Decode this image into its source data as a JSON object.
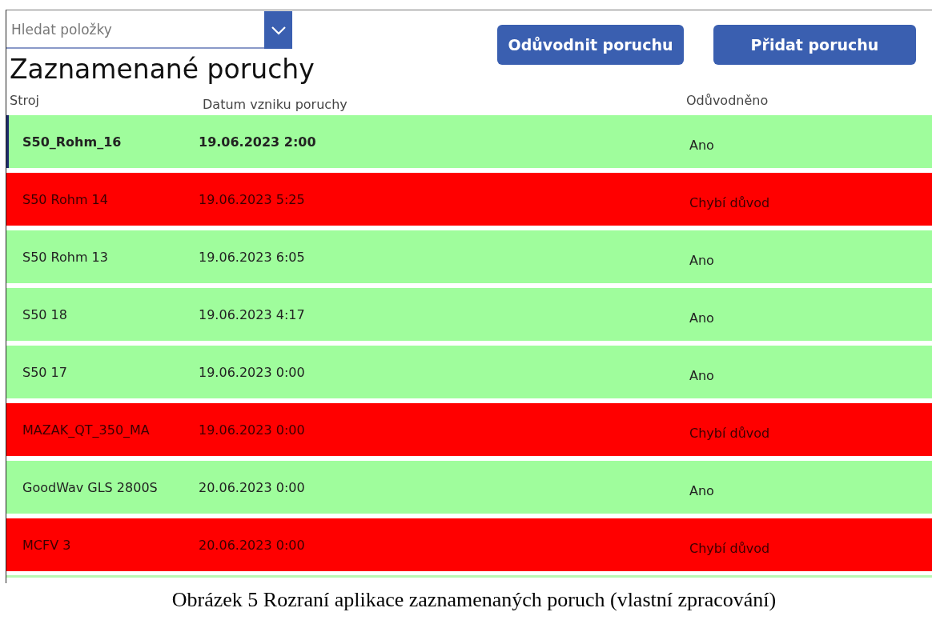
{
  "search": {
    "placeholder": "Hledat položky"
  },
  "buttons": [
    "Odůvodnit poruchu",
    "Přidat poruchu"
  ],
  "title": "Zaznamenané poruchy",
  "columns": [
    "Stroj",
    "Datum vzniku poruchy",
    "Odůvodněno"
  ],
  "rows": [
    {
      "machine": "S50_Rohm_16",
      "date": "19.06.2023 2:00",
      "status": "Ano",
      "justified": true,
      "selected": true
    },
    {
      "machine": "S50 Rohm 14",
      "date": "19.06.2023 5:25",
      "status": "Chybí důvod",
      "justified": false,
      "selected": false
    },
    {
      "machine": "S50 Rohm 13",
      "date": "19.06.2023 6:05",
      "status": "Ano",
      "justified": true,
      "selected": false
    },
    {
      "machine": "S50 18",
      "date": "19.06.2023 4:17",
      "status": "Ano",
      "justified": true,
      "selected": false
    },
    {
      "machine": "S50 17",
      "date": "19.06.2023 0:00",
      "status": "Ano",
      "justified": true,
      "selected": false
    },
    {
      "machine": "MAZAK_QT_350_MA",
      "date": "19.06.2023 0:00",
      "status": "Chybí důvod",
      "justified": false,
      "selected": false
    },
    {
      "machine": "GoodWav GLS 2800S",
      "date": "20.06.2023 0:00",
      "status": "Ano",
      "justified": true,
      "selected": false
    },
    {
      "machine": "MCFV 3",
      "date": "20.06.2023 0:00",
      "status": "Chybí důvod",
      "justified": false,
      "selected": false
    }
  ],
  "caption": "Obrázek 5 Rozraní aplikace zaznamenaných poruch (vlastní zpracování)"
}
